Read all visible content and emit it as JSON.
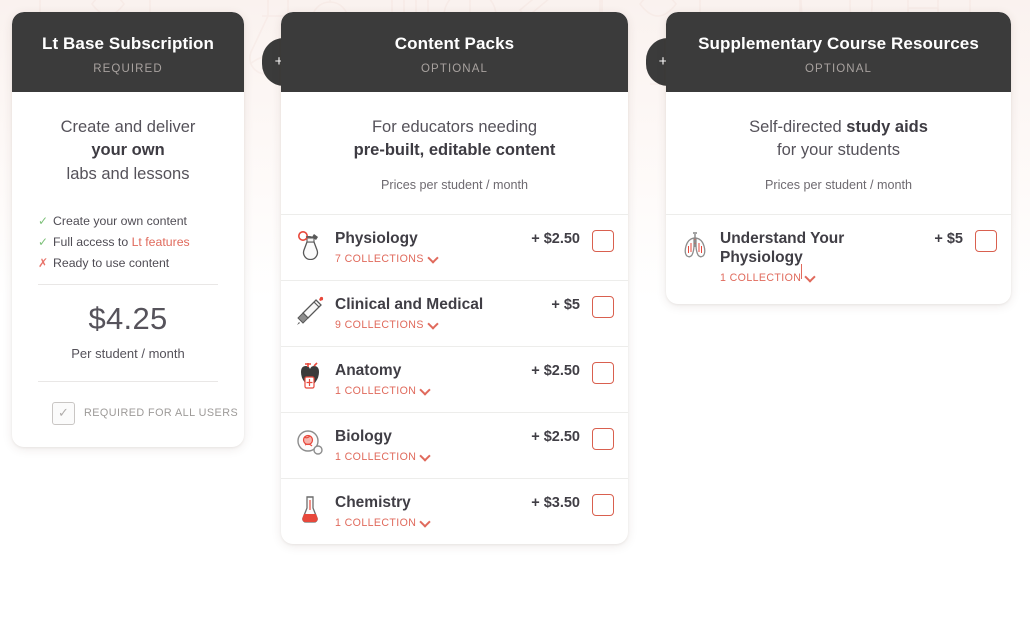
{
  "colors": {
    "header_bg": "#3b3b3b",
    "accent": "#e06a5c",
    "checkbox_border": "#d9604f",
    "tick_green": "#7ec17a",
    "cross_red": "#e8736a",
    "page_bg": "#ffffff",
    "wash_top": "#faf2ef"
  },
  "connectors": [
    {
      "name": "plus-connector-1",
      "label": "+"
    },
    {
      "name": "plus-connector-2",
      "label": "+"
    }
  ],
  "base_card": {
    "title": "Lt Base Subscription",
    "subtitle": "REQUIRED",
    "pitch_line1": "Create and deliver",
    "pitch_line2": "your own",
    "pitch_line3": "labs and lessons",
    "features": [
      {
        "mark": "✓",
        "state": "included",
        "text": "Create your own content",
        "link_text": ""
      },
      {
        "mark": "✓",
        "state": "included",
        "text": "Full access to ",
        "link_text": "Lt features"
      },
      {
        "mark": "✗",
        "state": "excluded",
        "text": "Ready to use content",
        "link_text": ""
      }
    ],
    "price": "$4.25",
    "price_note": "Per student / month",
    "required_checkbox": {
      "checked": true,
      "glyph": "✓",
      "label": "REQUIRED FOR ALL USERS"
    }
  },
  "content_packs_card": {
    "title": "Content Packs",
    "subtitle": "OPTIONAL",
    "blurb_line1": "For educators needing",
    "blurb_line2": "pre-built, editable content",
    "blurb_note": "Prices per student / month",
    "items": [
      {
        "icon": "physiology-icon",
        "name": "Physiology",
        "price": "+ $2.50",
        "collections": "7 COLLECTIONS",
        "checked": false,
        "cursor": false
      },
      {
        "icon": "clinical-medical-icon",
        "name": "Clinical and Medical",
        "price": "+ $5",
        "collections": "9 COLLECTIONS",
        "checked": false,
        "cursor": false
      },
      {
        "icon": "anatomy-icon",
        "name": "Anatomy",
        "price": "+ $2.50",
        "collections": "1 COLLECTION",
        "checked": false,
        "cursor": false
      },
      {
        "icon": "biology-icon",
        "name": "Biology",
        "price": "+ $2.50",
        "collections": "1 COLLECTION",
        "checked": false,
        "cursor": false
      },
      {
        "icon": "chemistry-icon",
        "name": "Chemistry",
        "price": "+ $3.50",
        "collections": "1 COLLECTION",
        "checked": false,
        "cursor": false
      }
    ]
  },
  "supplementary_card": {
    "title": "Supplementary Course Resources",
    "subtitle": "OPTIONAL",
    "blurb_line1": "Self-directed ",
    "blurb_line1_bold": "study aids",
    "blurb_line2": "for your students",
    "blurb_note": "Prices per student / month",
    "items": [
      {
        "icon": "lungs-icon",
        "name": "Understand Your Physiology",
        "price": "+ $5",
        "collections": "1 COLLECTION",
        "checked": false,
        "cursor": true
      }
    ]
  }
}
